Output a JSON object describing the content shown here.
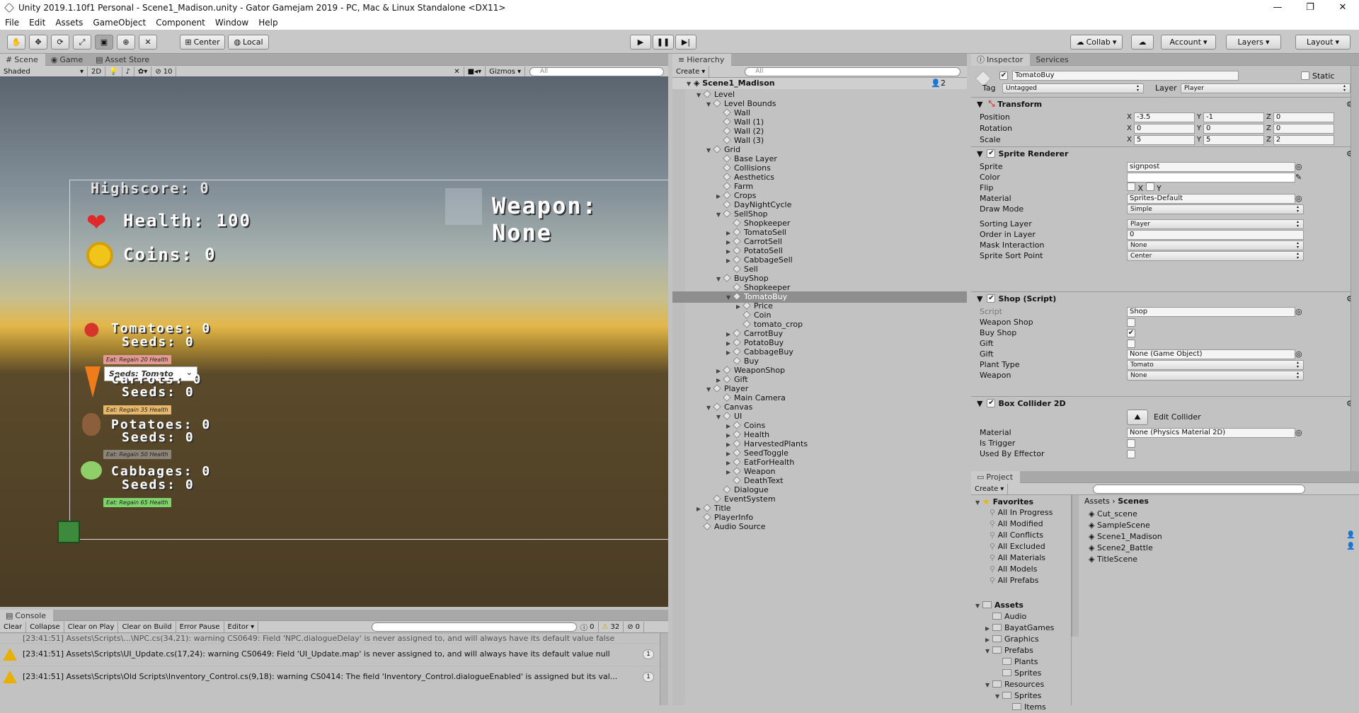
{
  "window": {
    "title": "Unity 2019.1.10f1 Personal - Scene1_Madison.unity - Gator Gamejam 2019 - PC, Mac & Linux Standalone <DX11>"
  },
  "menu": [
    "File",
    "Edit",
    "Assets",
    "GameObject",
    "Component",
    "Window",
    "Help"
  ],
  "toolbar": {
    "center": "Center",
    "local": "Local",
    "collab": "Collab",
    "account": "Account",
    "layers": "Layers",
    "layout": "Layout"
  },
  "scene_tabs": {
    "scene": "Scene",
    "game": "Game",
    "asset_store": "Asset Store"
  },
  "scene_bar": {
    "shaded": "Shaded",
    "mode2d": "2D",
    "fx_count": "10",
    "gizmos": "Gizmos",
    "search": "All"
  },
  "game": {
    "highscore": "Highscore: 0",
    "health": "Health: 100",
    "coins": "Coins: 0",
    "weapon": "Weapon: None",
    "seeds_dropdown": "Seeds: Tomato",
    "crops": [
      {
        "name": "Tomatoes: 0",
        "seeds": "Seeds: 0",
        "eat": "Eat: Regain 20 Health",
        "color": "#e39a92"
      },
      {
        "name": "Carrots: 0",
        "seeds": "Seeds: 0",
        "eat": "Eat: Regain 35 Health",
        "color": "#e8b86a"
      },
      {
        "name": "Potatoes: 0",
        "seeds": "Seeds: 0",
        "eat": "Eat: Regain 50 Health",
        "color": "#8d8579"
      },
      {
        "name": "Cabbages: 0",
        "seeds": "Seeds: 0",
        "eat": "Eat: Regain 65 Health",
        "color": "#7ed36a"
      }
    ]
  },
  "console": {
    "tab": "Console",
    "buttons": [
      "Clear",
      "Collapse",
      "Clear on Play",
      "Clear on Build",
      "Error Pause",
      "Editor"
    ],
    "info_count": "0",
    "warn_count": "32",
    "err_count": "0",
    "rows": [
      {
        "text": "[23:41:51] Assets\\Scripts\\UI_Update.cs(17,24): warning CS0649: Field 'UI_Update.map' is never assigned to, and will always have its default value null",
        "count": "1"
      },
      {
        "text": "[23:41:51] Assets\\Scripts\\Old Scripts\\Inventory_Control.cs(9,18): warning CS0414: The field 'Inventory_Control.dialogueEnabled' is assigned but its val...",
        "count": "1"
      }
    ],
    "partial_row": "[23:41:51] Assets\\Scripts\\...\\NPC.cs(34,21): warning CS0649: Field 'NPC.dialogueDelay' is never assigned to, and will always have its default value false"
  },
  "hierarchy": {
    "tab": "Hierarchy",
    "create": "Create",
    "search": "All",
    "scene": "Scene1_Madison",
    "badge": "2",
    "items": [
      {
        "d": 1,
        "a": "▼",
        "t": "Level"
      },
      {
        "d": 2,
        "a": "▼",
        "t": "Level Bounds"
      },
      {
        "d": 3,
        "a": "",
        "t": "Wall"
      },
      {
        "d": 3,
        "a": "",
        "t": "Wall (1)"
      },
      {
        "d": 3,
        "a": "",
        "t": "Wall (2)"
      },
      {
        "d": 3,
        "a": "",
        "t": "Wall (3)"
      },
      {
        "d": 2,
        "a": "▼",
        "t": "Grid"
      },
      {
        "d": 3,
        "a": "",
        "t": "Base Layer"
      },
      {
        "d": 3,
        "a": "",
        "t": "Collisions"
      },
      {
        "d": 3,
        "a": "",
        "t": "Aesthetics"
      },
      {
        "d": 3,
        "a": "",
        "t": "Farm"
      },
      {
        "d": 3,
        "a": "▶",
        "t": "Crops"
      },
      {
        "d": 3,
        "a": "",
        "t": "DayNightCycle"
      },
      {
        "d": 3,
        "a": "▼",
        "t": "SellShop"
      },
      {
        "d": 4,
        "a": "",
        "t": "Shopkeeper"
      },
      {
        "d": 4,
        "a": "▶",
        "t": "TomatoSell"
      },
      {
        "d": 4,
        "a": "▶",
        "t": "CarrotSell"
      },
      {
        "d": 4,
        "a": "▶",
        "t": "PotatoSell"
      },
      {
        "d": 4,
        "a": "▶",
        "t": "CabbageSell"
      },
      {
        "d": 4,
        "a": "",
        "t": "Sell"
      },
      {
        "d": 3,
        "a": "▼",
        "t": "BuyShop"
      },
      {
        "d": 4,
        "a": "",
        "t": "Shopkeeper"
      },
      {
        "d": 4,
        "a": "▼",
        "t": "TomatoBuy",
        "sel": true
      },
      {
        "d": 5,
        "a": "▶",
        "t": "Price"
      },
      {
        "d": 5,
        "a": "",
        "t": "Coin"
      },
      {
        "d": 5,
        "a": "",
        "t": "tomato_crop"
      },
      {
        "d": 4,
        "a": "▶",
        "t": "CarrotBuy"
      },
      {
        "d": 4,
        "a": "▶",
        "t": "PotatoBuy"
      },
      {
        "d": 4,
        "a": "▶",
        "t": "CabbageBuy"
      },
      {
        "d": 4,
        "a": "",
        "t": "Buy"
      },
      {
        "d": 3,
        "a": "▶",
        "t": "WeaponShop"
      },
      {
        "d": 3,
        "a": "▶",
        "t": "Gift"
      },
      {
        "d": 2,
        "a": "▼",
        "t": "Player"
      },
      {
        "d": 3,
        "a": "",
        "t": "Main Camera"
      },
      {
        "d": 2,
        "a": "▼",
        "t": "Canvas"
      },
      {
        "d": 3,
        "a": "▼",
        "t": "UI"
      },
      {
        "d": 4,
        "a": "▶",
        "t": "Coins"
      },
      {
        "d": 4,
        "a": "▶",
        "t": "Health"
      },
      {
        "d": 4,
        "a": "▶",
        "t": "HarvestedPlants"
      },
      {
        "d": 4,
        "a": "▶",
        "t": "SeedToggle"
      },
      {
        "d": 4,
        "a": "▶",
        "t": "EatForHealth"
      },
      {
        "d": 4,
        "a": "▶",
        "t": "Weapon"
      },
      {
        "d": 4,
        "a": "",
        "t": "DeathText"
      },
      {
        "d": 3,
        "a": "",
        "t": "Dialogue"
      },
      {
        "d": 2,
        "a": "",
        "t": "EventSystem"
      },
      {
        "d": 1,
        "a": "▶",
        "t": "Title"
      },
      {
        "d": 1,
        "a": "",
        "t": "PlayerInfo"
      },
      {
        "d": 1,
        "a": "",
        "t": "Audio Source"
      }
    ]
  },
  "inspector": {
    "tab": "Inspector",
    "services": "Services",
    "name": "TomatoBuy",
    "static": "Static",
    "tag_label": "Tag",
    "tag": "Untagged",
    "layer_label": "Layer",
    "layer": "Player",
    "transform": {
      "title": "Transform",
      "pos": [
        "-3.5",
        "-1",
        "0"
      ],
      "rot": [
        "0",
        "0",
        "0"
      ],
      "scale": [
        "5",
        "5",
        "2"
      ],
      "labels": [
        "Position",
        "Rotation",
        "Scale"
      ]
    },
    "sprite": {
      "title": "Sprite Renderer",
      "rows": [
        [
          "Sprite",
          "signpost"
        ],
        [
          "Color",
          ""
        ],
        [
          "Flip",
          ""
        ],
        [
          "Material",
          "Sprites-Default"
        ],
        [
          "Draw Mode",
          "Simple"
        ],
        [
          "Sorting Layer",
          "Player"
        ],
        [
          "Order in Layer",
          "0"
        ],
        [
          "Mask Interaction",
          "None"
        ],
        [
          "Sprite Sort Point",
          "Center"
        ]
      ]
    },
    "shop": {
      "title": "Shop (Script)",
      "rows": [
        [
          "Script",
          "Shop"
        ],
        [
          "Weapon Shop",
          ""
        ],
        [
          "Buy Shop",
          ""
        ],
        [
          "Gift",
          ""
        ],
        [
          "Gift",
          "None (Game Object)"
        ],
        [
          "Plant Type",
          "Tomato"
        ],
        [
          "Weapon",
          "None"
        ]
      ]
    },
    "collider": {
      "title": "Box Collider 2D",
      "edit": "Edit Collider",
      "rows": [
        [
          "Material",
          "None (Physics Material 2D)"
        ],
        [
          "Is Trigger",
          ""
        ],
        [
          "Used By Effector",
          ""
        ]
      ]
    }
  },
  "project": {
    "tab": "Project",
    "create": "Create",
    "favorites": "Favorites",
    "fav_items": [
      "All In Progress",
      "All Modified",
      "All Conflicts",
      "All Excluded",
      "All Materials",
      "All Models",
      "All Prefabs"
    ],
    "assets": "Assets",
    "asset_items": [
      {
        "t": "Audio",
        "d": 1,
        "a": ""
      },
      {
        "t": "BayatGames",
        "d": 1,
        "a": "▶"
      },
      {
        "t": "Graphics",
        "d": 1,
        "a": "▶"
      },
      {
        "t": "Prefabs",
        "d": 1,
        "a": "▼"
      },
      {
        "t": "Plants",
        "d": 2,
        "a": ""
      },
      {
        "t": "Sprites",
        "d": 2,
        "a": ""
      },
      {
        "t": "Resources",
        "d": 1,
        "a": "▼"
      },
      {
        "t": "Sprites",
        "d": 2,
        "a": "▼"
      },
      {
        "t": "Items",
        "d": 3,
        "a": ""
      }
    ],
    "breadcrumb_root": "Assets",
    "breadcrumb_leaf": "Scenes",
    "scenes": [
      "Cut_scene",
      "SampleScene",
      "Scene1_Madison",
      "Scene2_Battle",
      "TitleScene"
    ]
  }
}
